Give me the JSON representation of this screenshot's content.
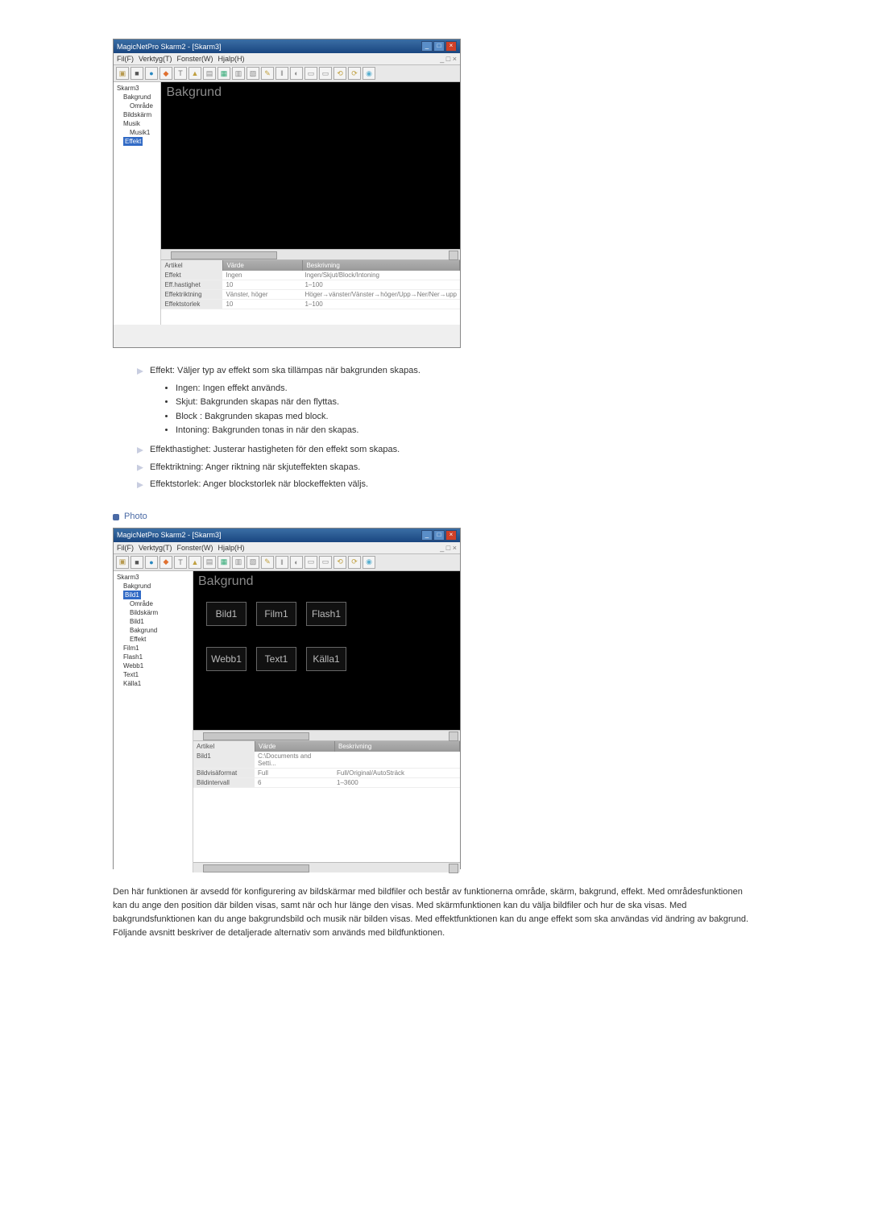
{
  "screenshot1": {
    "title": "MagicNetPro Skarm2 - [Skarm3]",
    "menus": [
      "Fil(F)",
      "Verktyg(T)",
      "Fonster(W)",
      "Hjalp(H)"
    ],
    "canvas_heading": "Bakgrund",
    "tree": [
      {
        "label": "Skarm3",
        "indent": 0
      },
      {
        "label": "Bakgrund",
        "indent": 1
      },
      {
        "label": "Område",
        "indent": 2
      },
      {
        "label": "Bildskärm",
        "indent": 1
      },
      {
        "label": "Musik",
        "indent": 1
      },
      {
        "label": "Musik1",
        "indent": 2
      },
      {
        "label": "Effekt",
        "indent": 1,
        "selected": true
      }
    ],
    "prop_headers": [
      "Artikel",
      "Värde",
      "Beskrivning"
    ],
    "prop_rows": [
      [
        "Effekt",
        "Ingen",
        "Ingen/Skjut/Block/Intoning"
      ],
      [
        "Eff.hastighet",
        "10",
        "1–100"
      ],
      [
        "Effektriktning",
        "Vänster, höger",
        "Höger→vänster/Vänster→höger/Upp→Ner/Ner→upp"
      ],
      [
        "Effektstorlek",
        "10",
        "1–100"
      ]
    ]
  },
  "doc1": {
    "items": [
      "Effekt: Väljer typ av effekt som ska tillämpas när bakgrunden skapas.",
      "Effekthastighet: Justerar hastigheten för den effekt som skapas.",
      "Effektriktning: Anger riktning när skjuteffekten skapas.",
      "Effektstorlek: Anger blockstorlek när blockeffekten väljs."
    ],
    "sublist": [
      "Ingen: Ingen effekt används.",
      "Skjut: Bakgrunden skapas när den flyttas.",
      "Block : Bakgrunden skapas med block.",
      "Intoning: Bakgrunden tonas in när den skapas."
    ]
  },
  "section_photo": "Photo",
  "screenshot2": {
    "title": "MagicNetPro Skarm2 - [Skarm3]",
    "menus": [
      "Fil(F)",
      "Verktyg(T)",
      "Fonster(W)",
      "Hjalp(H)"
    ],
    "canvas_heading": "Bakgrund",
    "tiles": [
      "Bild1",
      "Film1",
      "Flash1",
      "Webb1",
      "Text1",
      "Källa1"
    ],
    "tree": [
      {
        "label": "Skarm3",
        "indent": 0
      },
      {
        "label": "Bakgrund",
        "indent": 1
      },
      {
        "label": "Bild1",
        "indent": 1,
        "selected": true
      },
      {
        "label": "Område",
        "indent": 2
      },
      {
        "label": "Bildskärm",
        "indent": 2
      },
      {
        "label": "Bild1",
        "indent": 2
      },
      {
        "label": "Bakgrund",
        "indent": 2
      },
      {
        "label": "Effekt",
        "indent": 2
      },
      {
        "label": "Film1",
        "indent": 1
      },
      {
        "label": "Flash1",
        "indent": 1
      },
      {
        "label": "Webb1",
        "indent": 1
      },
      {
        "label": "Text1",
        "indent": 1
      },
      {
        "label": "Källa1",
        "indent": 1
      }
    ],
    "prop_headers": [
      "Artikel",
      "Värde",
      "Beskrivning"
    ],
    "prop_rows": [
      [
        "Bild1",
        "C:\\Documents and Setti...",
        ""
      ],
      [
        "Bildvisäformat",
        "Full",
        "Full/Original/AutoSträck"
      ],
      [
        "Bildintervall",
        "6",
        "1–3600"
      ]
    ]
  },
  "doc2": "Den här funktionen är avsedd för konfigurering av bildskärmar med bildfiler och består av funktionerna område, skärm, bakgrund, effekt. Med områdesfunktionen kan du ange den position där bilden visas, samt när och hur länge den visas. Med skärmfunktionen kan du välja bildfiler och hur de ska visas. Med bakgrundsfunktionen kan du ange bakgrundsbild och musik när bilden visas. Med effektfunktionen kan du ange effekt som ska användas vid ändring av bakgrund. Följande avsnitt beskriver de detaljerade alternativ som används med bildfunktionen."
}
